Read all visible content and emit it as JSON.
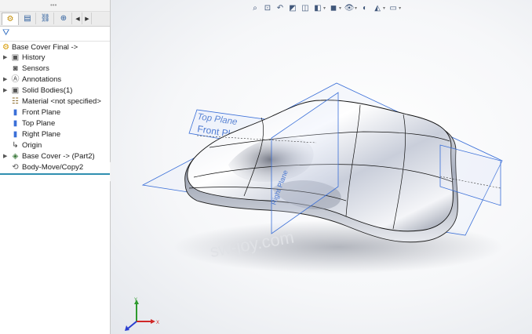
{
  "feature_manager": {
    "filter_icon": "funnel-icon",
    "tabs": [
      {
        "icon": "feature-manager-icon",
        "active": true
      },
      {
        "icon": "property-manager-icon",
        "active": false
      },
      {
        "icon": "configuration-manager-icon",
        "active": false
      },
      {
        "icon": "dimxpert-icon",
        "active": false
      }
    ],
    "root": "Base Cover Final ->",
    "items": [
      {
        "label": "History",
        "icon": "history-folder-icon",
        "expandable": true
      },
      {
        "label": "Sensors",
        "icon": "sensors-icon",
        "expandable": false
      },
      {
        "label": "Annotations",
        "icon": "annotations-icon",
        "expandable": true
      },
      {
        "label": "Solid Bodies(1)",
        "icon": "solid-bodies-icon",
        "expandable": true
      },
      {
        "label": "Material <not specified>",
        "icon": "material-icon",
        "expandable": false
      },
      {
        "label": "Front Plane",
        "icon": "plane-icon",
        "expandable": false
      },
      {
        "label": "Top Plane",
        "icon": "plane-icon",
        "expandable": false
      },
      {
        "label": "Right Plane",
        "icon": "plane-icon",
        "expandable": false
      },
      {
        "label": "Origin",
        "icon": "origin-icon",
        "expandable": false
      },
      {
        "label": "Base Cover -> (Part2)",
        "icon": "base-part-icon",
        "expandable": true
      },
      {
        "label": "Body-Move/Copy2",
        "icon": "move-copy-body-icon",
        "expandable": false
      }
    ]
  },
  "viewport": {
    "plane_labels": {
      "top": "Top Plane",
      "front": "Front Plane",
      "right": "Right Plane"
    },
    "watermark": "sw-joy.com",
    "triad": {
      "x": "X",
      "y": "Y",
      "z": "Z"
    },
    "plane_color": "#3a6fd8",
    "hud_icons": [
      "zoom-to-fit-icon",
      "zoom-to-area-icon",
      "previous-view-icon",
      "section-view-icon",
      "dynamic-annotation-icon",
      "view-orientation-icon",
      "display-style-icon",
      "hide-show-icon",
      "edit-appearance-icon",
      "apply-scene-icon",
      "view-settings-icon"
    ]
  }
}
